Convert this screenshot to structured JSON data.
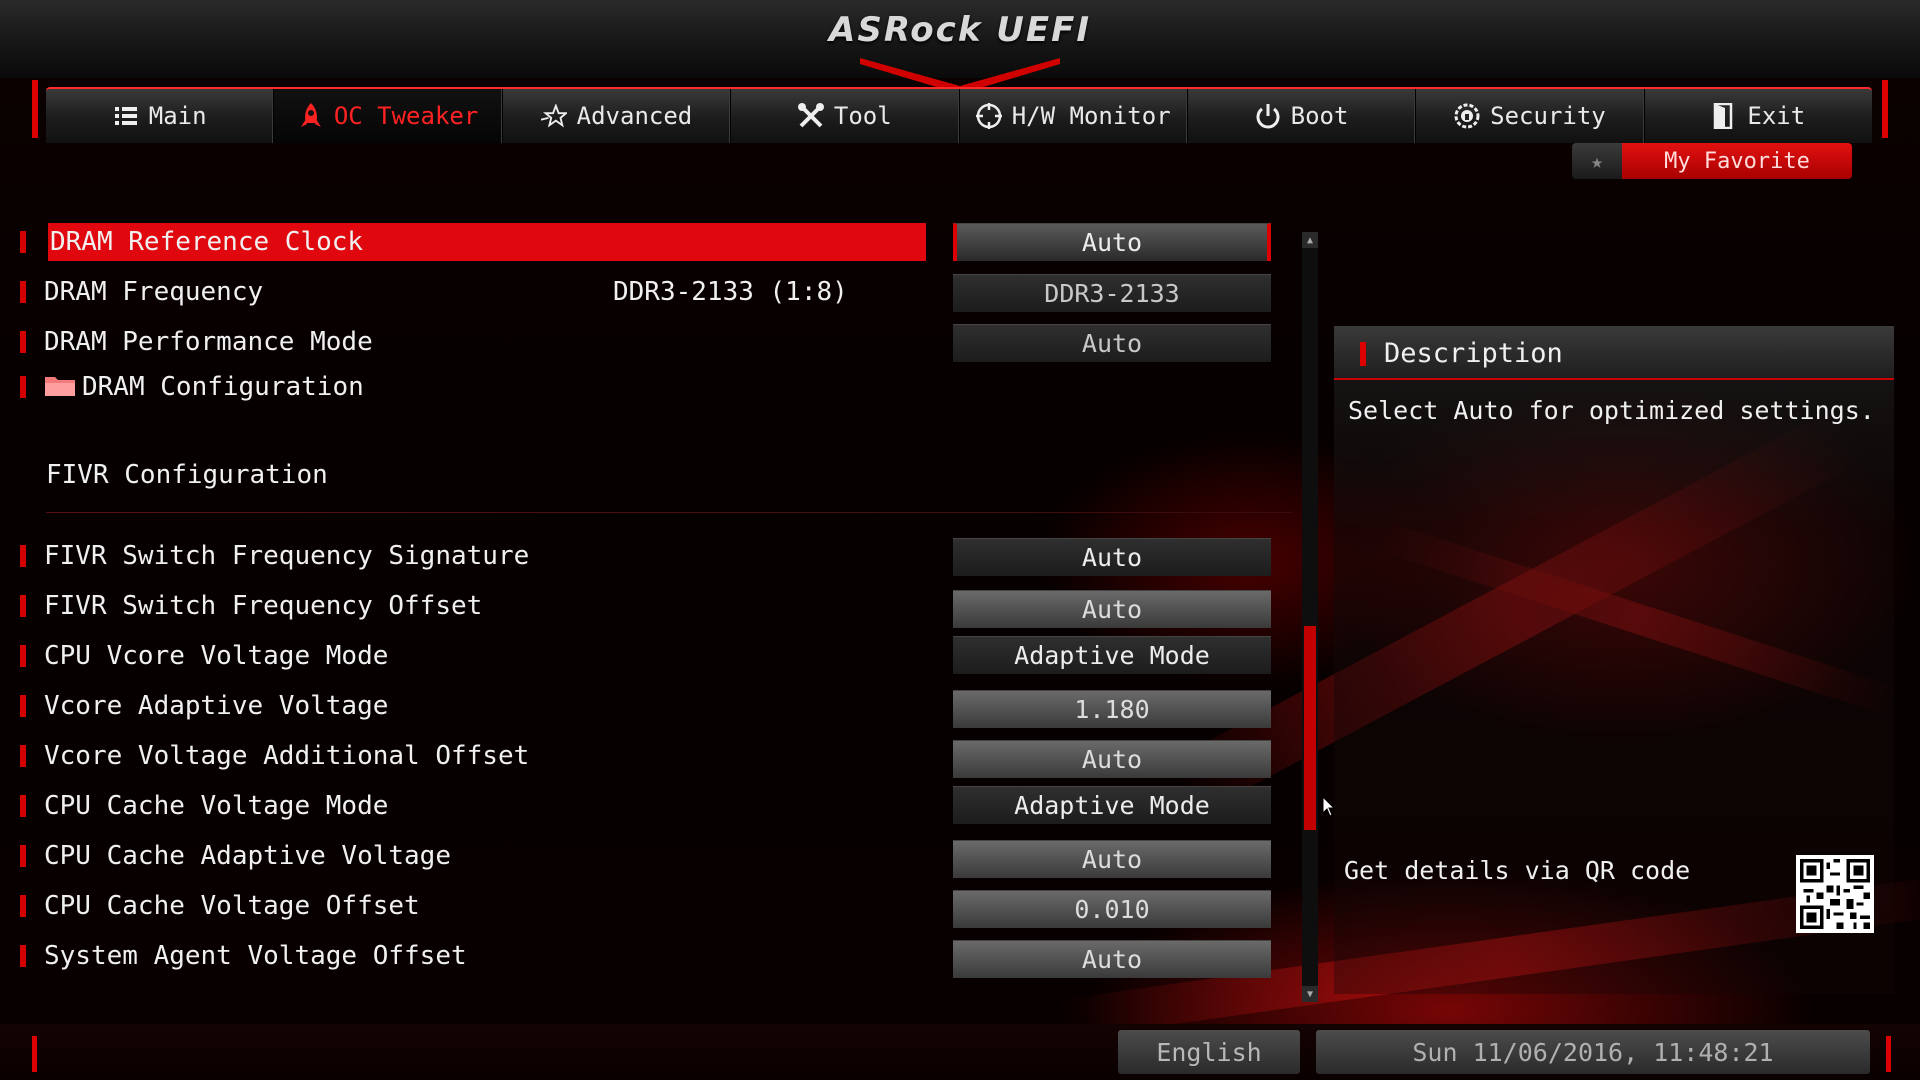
{
  "header": {
    "logo": "ASRock UEFI"
  },
  "tabs": [
    {
      "label": "Main",
      "icon": "list-icon",
      "active": false
    },
    {
      "label": "OC Tweaker",
      "icon": "rocket-icon",
      "active": true
    },
    {
      "label": "Advanced",
      "icon": "star-icon",
      "active": false
    },
    {
      "label": "Tool",
      "icon": "tools-icon",
      "active": false
    },
    {
      "label": "H/W Monitor",
      "icon": "crosshair-icon",
      "active": false
    },
    {
      "label": "Boot",
      "icon": "power-icon",
      "active": false
    },
    {
      "label": "Security",
      "icon": "shield-icon",
      "active": false
    },
    {
      "label": "Exit",
      "icon": "exit-door-icon",
      "active": false
    }
  ],
  "favorite": {
    "label": "My Favorite",
    "icon": "star-icon"
  },
  "settings_top": [
    {
      "label": "DRAM Reference Clock",
      "value": "Auto",
      "selected": true
    },
    {
      "label": "DRAM Frequency",
      "info": "DDR3-2133 (1:8)",
      "value": "DDR3-2133"
    },
    {
      "label": "DRAM Performance Mode",
      "value": "Auto"
    },
    {
      "label": "DRAM Configuration",
      "folder": true
    }
  ],
  "section_title": "FIVR Configuration",
  "settings_fivr": [
    {
      "label": "FIVR Switch Frequency Signature",
      "value": "Auto"
    },
    {
      "label": "FIVR Switch Frequency Offset",
      "value": "Auto"
    },
    {
      "label": "CPU Vcore Voltage Mode",
      "value": "Adaptive Mode"
    },
    {
      "label": "Vcore Adaptive Voltage",
      "value": "1.180"
    },
    {
      "label": "Vcore Voltage Additional Offset",
      "value": "Auto"
    },
    {
      "label": "CPU Cache Voltage Mode",
      "value": "Adaptive Mode"
    },
    {
      "label": "CPU Cache Adaptive Voltage",
      "value": "Auto"
    },
    {
      "label": "CPU Cache Voltage Offset",
      "value": "0.010"
    },
    {
      "label": "System Agent Voltage Offset",
      "value": "Auto"
    }
  ],
  "description": {
    "title": "Description",
    "text": "Select Auto for optimized settings.",
    "qr_label": "Get details via QR code"
  },
  "footer": {
    "language": "English",
    "datetime": "Sun 11/06/2016, 11:48:21"
  },
  "colors": {
    "accent": "#e0070e",
    "background": "#050000",
    "text": "#f0f0f0"
  }
}
